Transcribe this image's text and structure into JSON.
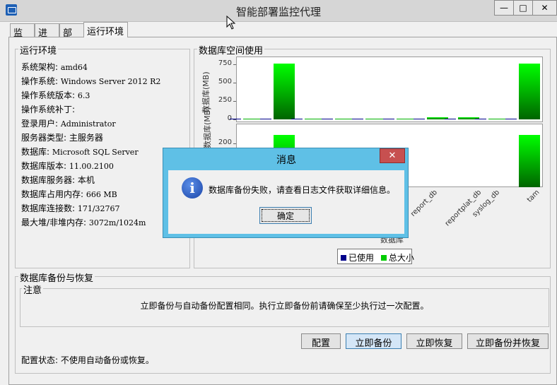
{
  "window": {
    "title": "智能部署监控代理",
    "min_glyph": "—",
    "max_glyph": "□",
    "close_glyph": "✕"
  },
  "tabs": [
    {
      "label": "监控",
      "active": false
    },
    {
      "label": "进程",
      "active": false
    },
    {
      "label": "部署",
      "active": false
    },
    {
      "label": "运行环境",
      "active": true
    }
  ],
  "env": {
    "title": "运行环境",
    "rows": [
      {
        "k": "系统架构: ",
        "v": "amd64"
      },
      {
        "k": "操作系统: ",
        "v": "Windows Server 2012 R2"
      },
      {
        "k": "操作系统版本: ",
        "v": "6.3"
      },
      {
        "k": "操作系统补丁: ",
        "v": ""
      },
      {
        "k": "登录用户: ",
        "v": "Administrator"
      },
      {
        "k": "服务器类型: 主服务器",
        "v": ""
      },
      {
        "k": "数据库: ",
        "v": "Microsoft SQL Server"
      },
      {
        "k": "数据库版本: ",
        "v": "11.00.2100"
      },
      {
        "k": "数据库服务器: 本机",
        "v": ""
      },
      {
        "k": "数据库占用内存: ",
        "v": "666 MB"
      },
      {
        "k": "数据库连接数: ",
        "v": "171/32767"
      },
      {
        "k": "最大堆/非堆内存: ",
        "v": "3072m/1024m"
      }
    ]
  },
  "db_space": {
    "title": "数据库空间使用"
  },
  "chart_data": [
    {
      "type": "bar",
      "ylabel": "数据库(MB)",
      "yticks": [
        0,
        250,
        500,
        750
      ],
      "ylim": [
        0,
        800
      ],
      "categories": [
        "",
        "",
        "",
        "",
        "",
        "",
        "",
        "",
        "",
        ""
      ],
      "series": [
        {
          "name": "已使用",
          "color": "#00008b",
          "values": [
            2,
            5,
            1,
            1,
            3,
            1,
            10,
            10,
            1,
            5
          ]
        },
        {
          "name": "总大小",
          "color": "#00dd00",
          "values": [
            2,
            760,
            1,
            1,
            10,
            1,
            30,
            30,
            1,
            760
          ]
        }
      ]
    },
    {
      "type": "bar",
      "ylabel": "数据库(MB)",
      "yticks": [
        200
      ],
      "ylim": [
        0,
        260
      ],
      "categories": [
        "",
        "",
        "",
        "",
        "",
        "report_db",
        "reportplat_db",
        "syslog_db",
        "",
        "tam"
      ],
      "series": [
        {
          "name": "已使用",
          "color": "#00008b",
          "values": [
            0,
            0,
            0,
            0,
            0,
            0,
            0,
            0,
            0,
            0
          ]
        },
        {
          "name": "总大小",
          "color": "#00dd00",
          "values": [
            0,
            240,
            0,
            0,
            0,
            0,
            0,
            0,
            0,
            240
          ]
        }
      ],
      "xlabel_fragment": "数据库"
    }
  ],
  "legend": {
    "used": "已使用",
    "total": "总大小",
    "used_color": "#00008b",
    "total_color": "#00cc00"
  },
  "backup": {
    "title": "数据库备份与恢复",
    "note_title": "注意",
    "note_text": "立即备份与自动备份配置相同。执行立即备份前请确保至少执行过一次配置。",
    "buttons": [
      "配置",
      "立即备份",
      "立即恢复",
      "立即备份并恢复"
    ],
    "status": "配置状态: 不使用自动备份或恢复。"
  },
  "dialog": {
    "title": "消息",
    "close_glyph": "✕",
    "icon_glyph": "i",
    "message": "数据库备份失败，请查看日志文件获取详细信息。",
    "ok": "确定"
  },
  "chart_label_fragment": "b"
}
